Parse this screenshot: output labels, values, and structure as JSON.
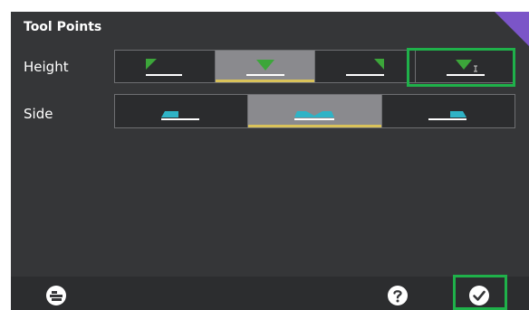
{
  "dialog": {
    "title": "Tool Points"
  },
  "rows": {
    "height": {
      "label": "Height",
      "options": [
        "left-edge-point",
        "center-point",
        "right-edge-point",
        "center-point-alt"
      ],
      "selected_index": 1,
      "highlighted_index": 3
    },
    "side": {
      "label": "Side",
      "options": [
        "left-side",
        "center",
        "right-side"
      ],
      "selected_index": 1
    }
  },
  "footer": {
    "left_icon": "machine-icon",
    "help_icon": "question-icon",
    "confirm_icon": "checkmark-icon"
  },
  "colors": {
    "panel_bg": "#353638",
    "selected_bg": "#8a8a8e",
    "selected_underline": "#d9c25a",
    "height_marker": "#3ca63a",
    "side_marker": "#2fb3c6",
    "highlight": "#1fb14a",
    "corner_accent": "#7b55c8"
  }
}
